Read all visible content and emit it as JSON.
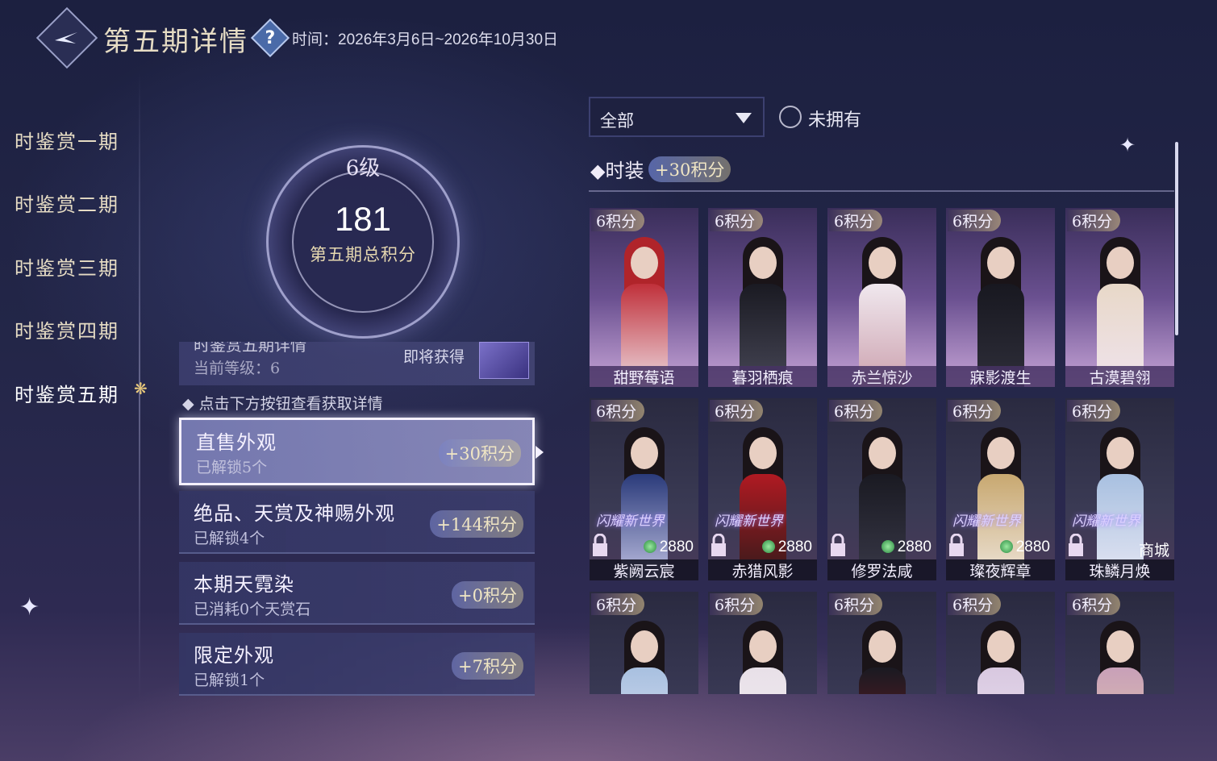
{
  "header": {
    "title": "第五期详情",
    "help_icon": "?",
    "time_text": "时间：2026年3月6日~2026年10月30日"
  },
  "sidebar": {
    "items": [
      {
        "label": "时鉴赏一期"
      },
      {
        "label": "时鉴赏二期"
      },
      {
        "label": "时鉴赏三期"
      },
      {
        "label": "时鉴赏四期"
      },
      {
        "label": "时鉴赏五期"
      }
    ],
    "active_index": 4
  },
  "score": {
    "level": "6级",
    "points": "181",
    "label": "第五期总积分"
  },
  "detail": {
    "title": "时鉴赏五期详情",
    "current_level": "当前等级：6",
    "upcoming": "即将获得"
  },
  "hint": "点击下方按钮查看获取详情",
  "categories": [
    {
      "title": "直售外观",
      "sub": "已解锁5个",
      "points": "+30积分"
    },
    {
      "title": "绝品、天赏及神赐外观",
      "sub": "已解锁4个",
      "points": "+144积分"
    },
    {
      "title": "本期天霓染",
      "sub": "已消耗0个天赏石",
      "points": "+0积分"
    },
    {
      "title": "限定外观",
      "sub": "已解锁1个",
      "points": "+7积分"
    }
  ],
  "filter": {
    "selected": "全部",
    "unowned_label": "未拥有"
  },
  "section": {
    "title": "时装",
    "points": "+30积分"
  },
  "outfits_row1": [
    {
      "badge": "6积分",
      "name": "甜野莓语"
    },
    {
      "badge": "6积分",
      "name": "暮羽栖痕"
    },
    {
      "badge": "6积分",
      "name": "赤兰惊沙"
    },
    {
      "badge": "6积分",
      "name": "寐影渡生"
    },
    {
      "badge": "6积分",
      "name": "古漠碧翎"
    }
  ],
  "outfits_row2": [
    {
      "badge": "6积分",
      "name": "紫阙云宸",
      "promo": "闪耀新世界",
      "price": "2880"
    },
    {
      "badge": "6积分",
      "name": "赤猎风影",
      "promo": "闪耀新世界",
      "price": "2880"
    },
    {
      "badge": "6积分",
      "name": "修罗法咸",
      "promo": "",
      "price": "2880"
    },
    {
      "badge": "6积分",
      "name": "璨夜辉章",
      "promo": "闪耀新世界",
      "price": "2880"
    },
    {
      "badge": "6积分",
      "name": "珠鳞月焕",
      "promo": "闪耀新世界",
      "price": "商城"
    }
  ],
  "outfits_row3": [
    {
      "badge": "6积分"
    },
    {
      "badge": "6积分"
    },
    {
      "badge": "6积分"
    },
    {
      "badge": "6积分"
    },
    {
      "badge": "6积分"
    }
  ],
  "colors": {
    "accent_gold": "#e6dcc4",
    "panel": "#343664",
    "selected_border": "#f4f0ff"
  }
}
